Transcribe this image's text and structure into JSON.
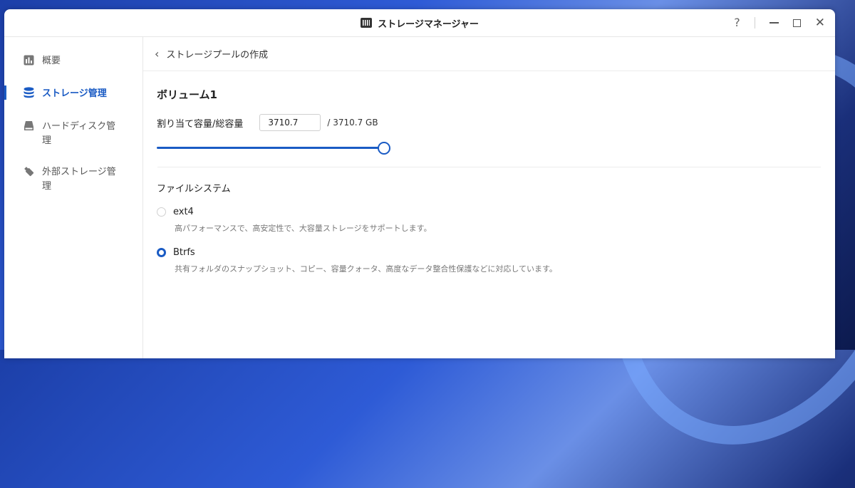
{
  "window": {
    "title": "ストレージマネージャー",
    "help_label": "?"
  },
  "sidebar": {
    "items": [
      {
        "label": "概要",
        "icon": "chart-icon"
      },
      {
        "label": "ストレージ管理",
        "icon": "database-icon"
      },
      {
        "label": "ハードディスク管理",
        "icon": "hard-disk-icon"
      },
      {
        "label": "外部ストレージ管理",
        "icon": "usb-drive-icon"
      }
    ]
  },
  "breadcrumb": {
    "label": "ストレージプールの作成"
  },
  "volume": {
    "title": "ボリューム1",
    "allocation_label": "割り当て容量/総容量",
    "allocation_value": "3710.7",
    "total_capacity": "/  3710.7 GB",
    "slider_fraction": 1.0
  },
  "filesystem": {
    "title": "ファイルシステム",
    "options": [
      {
        "label": "ext4",
        "description": "高パフォーマンスで、高安定性で、大容量ストレージをサポートします。",
        "selected": false
      },
      {
        "label": "Btrfs",
        "description": "共有フォルダのスナップショット、コピー、容量クォータ、高度なデータ整合性保護などに対応しています。",
        "selected": true
      }
    ]
  },
  "colors": {
    "accent": "#1a5bc4"
  }
}
